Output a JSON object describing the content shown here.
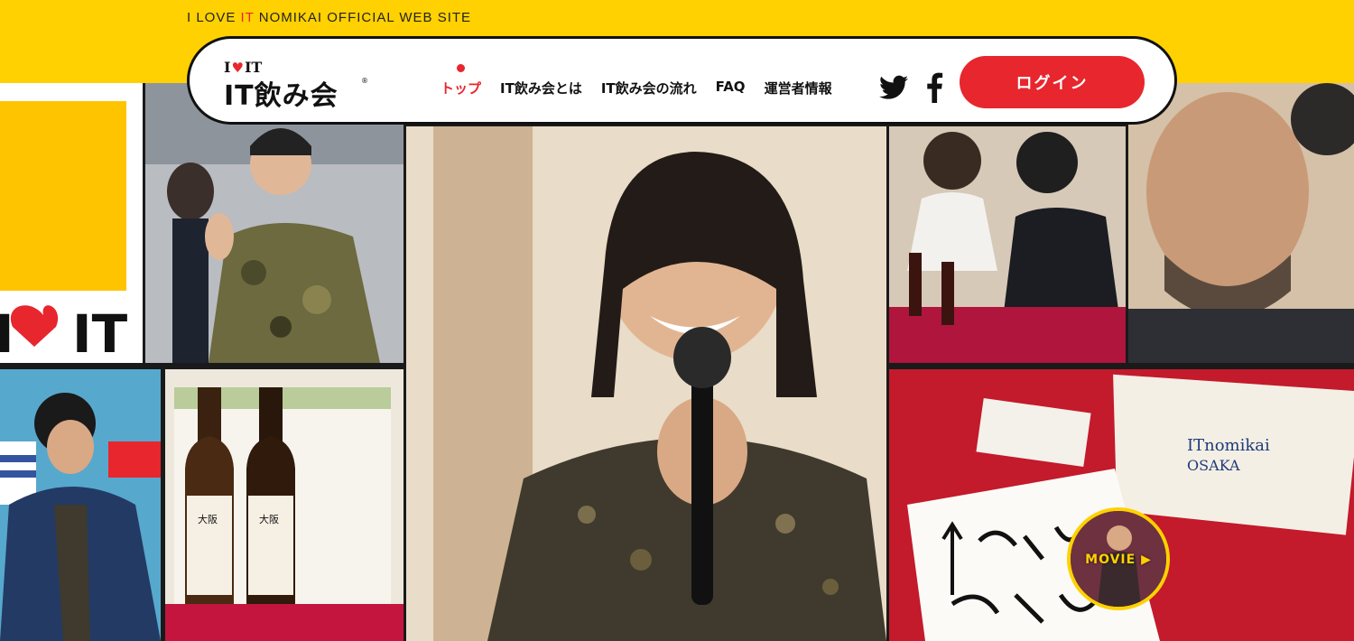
{
  "site": {
    "tagline_prefix": "I LOVE ",
    "tagline_accent": "IT",
    "tagline_suffix": " NOMIKAI OFFICIAL WEB SITE"
  },
  "logo": {
    "top_i": "I",
    "top_it": "IT",
    "main": "IT飲み会",
    "registered": "®"
  },
  "nav": {
    "items": [
      {
        "label": "トップ",
        "active": true
      },
      {
        "label": "IT飲み会とは",
        "active": false
      },
      {
        "label": "IT飲み会の流れ",
        "active": false
      },
      {
        "label": "FAQ",
        "active": false
      },
      {
        "label": "運営者情報",
        "active": false
      }
    ]
  },
  "social": [
    "twitter-icon",
    "facebook-icon"
  ],
  "login": {
    "label": "ログイン"
  },
  "movie": {
    "label": "MOVIE ▶"
  },
  "colors": {
    "brand_yellow": "#ffd100",
    "brand_red": "#e8262d",
    "ink": "#111111"
  }
}
